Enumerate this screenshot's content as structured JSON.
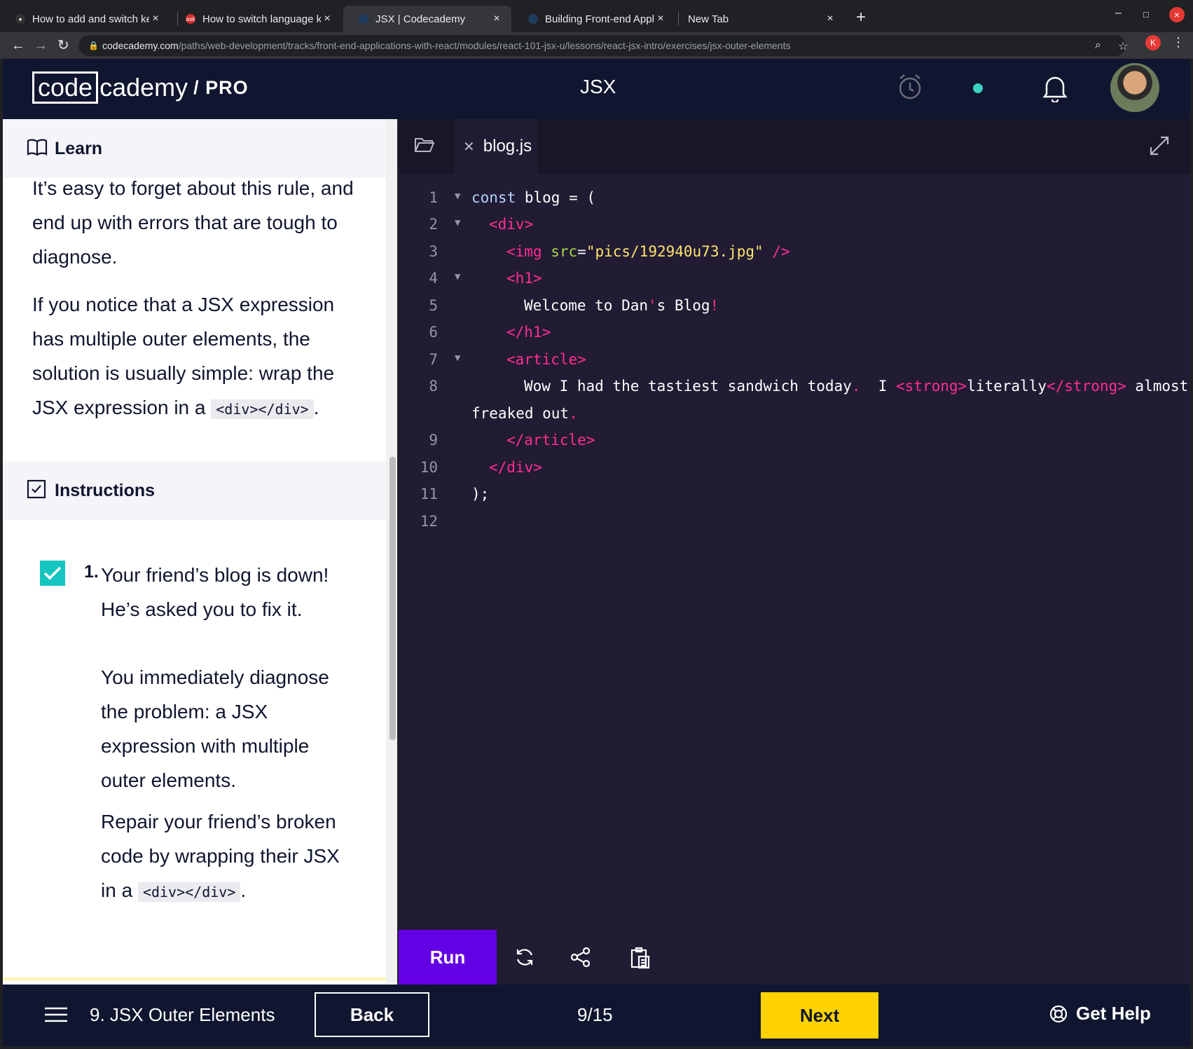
{
  "browser": {
    "tabs": [
      {
        "title": "How to add and switch ke",
        "favicon": "ubuntu-icon"
      },
      {
        "title": "How to switch language k",
        "favicon": "askubuntu-icon"
      },
      {
        "title": "JSX | Codecademy",
        "favicon": "codecademy-icon"
      },
      {
        "title": "Building Front-end Applic",
        "favicon": "codecademy-icon"
      },
      {
        "title": "New Tab",
        "favicon": ""
      }
    ],
    "url_host": "codecademy.com",
    "url_path": "/paths/web-development/tracks/front-end-applications-with-react/modules/react-101-jsx-u/lessons/react-jsx-intro/exercises/jsx-outer-elements",
    "profile_initial": "K"
  },
  "header": {
    "logo_box": "code",
    "logo_rest": "cademy",
    "logo_pro": "/ PRO",
    "title": "JSX"
  },
  "learn": {
    "heading": "Learn",
    "para1": "It’s easy to forget about this rule, and end up with errors that are tough to diagnose.",
    "para2_before": "If you notice that a JSX expression has multiple outer elements, the solution is usually simple: wrap the JSX expression in a ",
    "para2_code": "<div></div>",
    "para2_after": "."
  },
  "instructions": {
    "heading": "Instructions",
    "step_number": "1.",
    "step_p1": "Your friend’s blog is down! He’s asked you to fix it.",
    "step_p2": "You immediately diagnose the problem: a JSX expression with multiple outer elements.",
    "step_p3_before": "Repair your friend’s broken code by wrapping their JSX in a ",
    "step_p3_code": "<div></div>",
    "step_p3_after": "."
  },
  "editor": {
    "file_name": "blog.js",
    "line_numbers": [
      "1",
      "2",
      "3",
      "4",
      "5",
      "6",
      "7",
      "8",
      "9",
      "10",
      "11",
      "12"
    ],
    "code": {
      "l1_kw": "const",
      "l1_rest": " blog = (",
      "l2": "<div>",
      "l3_open": "<img ",
      "l3_attr": "src",
      "l3_eq": "=",
      "l3_str": "\"pics/192940u73.jpg\"",
      "l3_close": " />",
      "l4": "<h1>",
      "l5_a": "Welcome to Dan",
      "l5_b": "'",
      "l5_c": "s Blog",
      "l5_d": "!",
      "l6": "</h1>",
      "l7": "<article>",
      "l8_a": "Wow I had the tastiest sandwich today",
      "l8_b": ".",
      "l8_c": "  I ",
      "l8_d": "<strong>",
      "l8_e": "literally",
      "l8_f": "</strong>",
      "l8_g": " almost",
      "l8w_a": "freaked out",
      "l8w_b": ".",
      "l9": "</article>",
      "l10": "</div>",
      "l11": ");"
    }
  },
  "runbar": {
    "run_label": "Run"
  },
  "footer": {
    "lesson": "9. JSX Outer Elements",
    "back": "Back",
    "progress": "9/15",
    "next": "Next",
    "help": "Get Help"
  },
  "colors": {
    "brand_navy": "#10162f",
    "run_purple": "#6400e4",
    "next_yellow": "#ffd300",
    "check_teal": "#15c5c0",
    "tag_pink": "#ff2f8e"
  }
}
